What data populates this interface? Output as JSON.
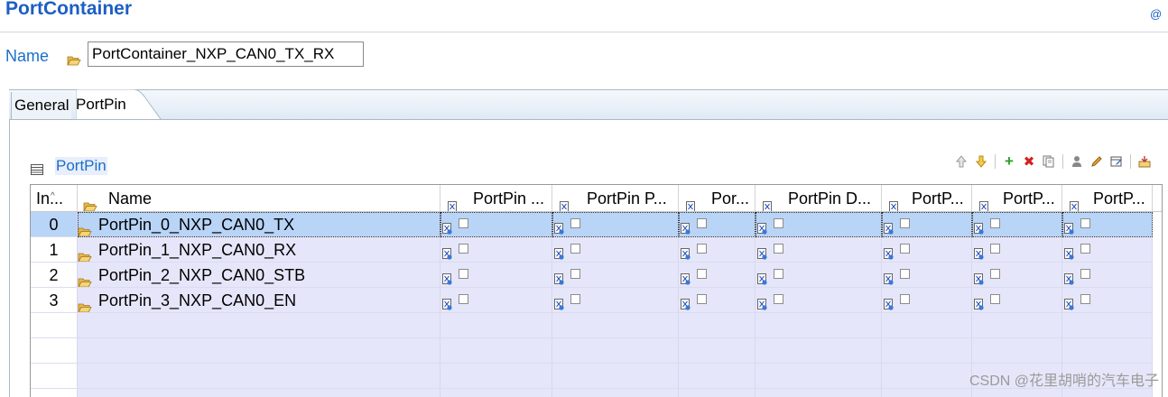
{
  "header": {
    "title": "PortContainer",
    "corner_icon": "at-icon"
  },
  "name_field": {
    "label": "Name",
    "value": "PortContainer_NXP_CAN0_TX_RX"
  },
  "tabs": [
    {
      "label": "General"
    },
    {
      "label": "PortPin",
      "active": true
    }
  ],
  "section": {
    "title": "PortPin"
  },
  "toolbar": {
    "items": [
      "move-up-icon",
      "move-down-icon",
      "add-icon",
      "delete-icon",
      "copy-icon",
      "user-icon",
      "edit-icon",
      "table-edit-icon",
      "import-icon"
    ]
  },
  "table": {
    "columns": [
      {
        "label": "In..."
      },
      {
        "label": "Name"
      },
      {
        "label": "PortPin ..."
      },
      {
        "label": "PortPin P..."
      },
      {
        "label": "Por..."
      },
      {
        "label": "PortPin D..."
      },
      {
        "label": "PortP..."
      },
      {
        "label": "PortP..."
      },
      {
        "label": "PortP..."
      }
    ],
    "rows": [
      {
        "index": "0",
        "name": "PortPin_0_NXP_CAN0_TX",
        "selected": true
      },
      {
        "index": "1",
        "name": "PortPin_1_NXP_CAN0_RX"
      },
      {
        "index": "2",
        "name": "PortPin_2_NXP_CAN0_STB"
      },
      {
        "index": "3",
        "name": "PortPin_3_NXP_CAN0_EN"
      }
    ]
  },
  "watermark": "CSDN @花里胡哨的汽车电子",
  "colors": {
    "accent": "#1c6ec9",
    "selected_row": "#b8d4f7",
    "row_bg": "#e6e6fa"
  }
}
